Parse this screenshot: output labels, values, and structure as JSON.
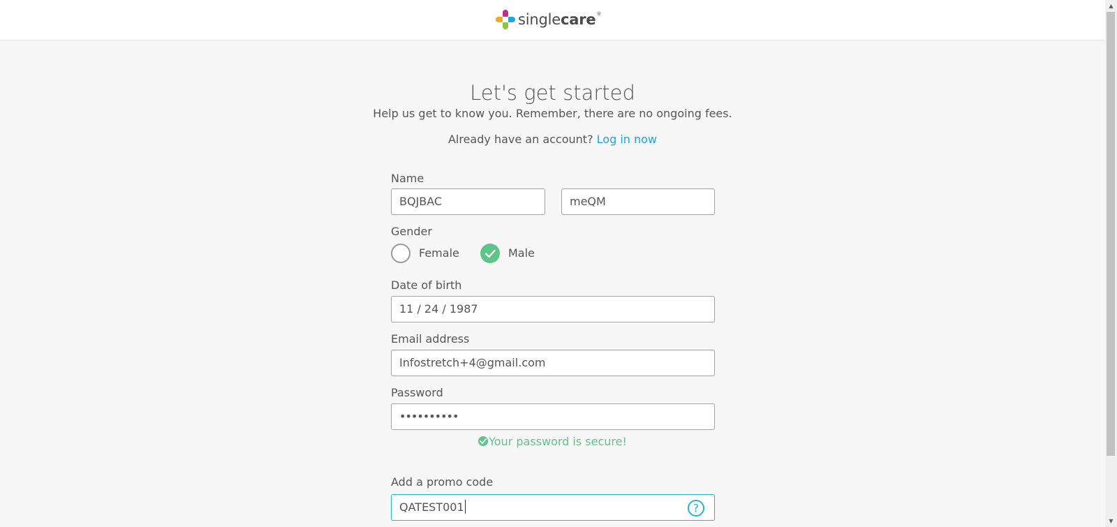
{
  "header": {
    "logo": {
      "name": "singlecare",
      "text_light": "single",
      "text_bold": "care",
      "reg_mark": "®"
    }
  },
  "intro": {
    "title": "Let's get started",
    "subtitle": "Help us get to know you. Remember, there are no ongoing fees.",
    "login_prompt": "Already have an account?",
    "login_link": "Log in now"
  },
  "form": {
    "name_label": "Name",
    "first_name_value": "BQJBAC",
    "last_name_value": "meQM",
    "gender_label": "Gender",
    "gender_options": [
      {
        "label": "Female",
        "selected": false
      },
      {
        "label": "Male",
        "selected": true
      }
    ],
    "dob_label": "Date of birth",
    "dob_value": "11 / 24 / 1987",
    "email_label": "Email address",
    "email_value": "Infostretch+4@gmail.com",
    "password_label": "Password",
    "password_value": "••••••••••",
    "password_status": "Your password is secure!",
    "promo_label": "Add a promo code",
    "promo_value": "QATEST001",
    "promo_help_icon": "?"
  },
  "colors": {
    "accent": "#20b7d2",
    "link": "#1ea5d7",
    "success": "#5cc587",
    "background": "#f7f7f7"
  }
}
